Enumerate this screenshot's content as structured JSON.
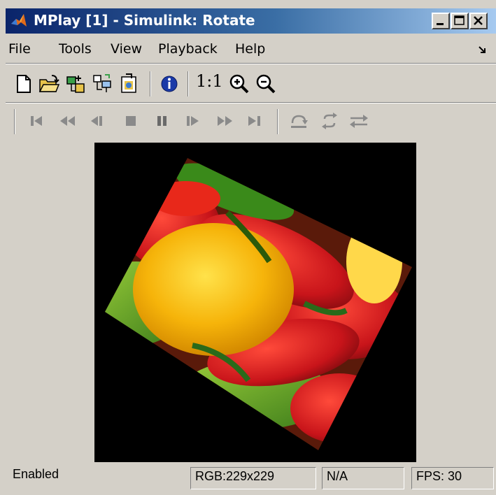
{
  "window": {
    "title": "MPlay [1] - Simulink: Rotate"
  },
  "menu": {
    "items": [
      "File",
      "Tools",
      "View",
      "Playback",
      "Help"
    ]
  },
  "toolbar": {
    "zoom_text": "1:1"
  },
  "video": {
    "content": "rotated image of colorful peppers (red, yellow, green)"
  },
  "status": {
    "state": "Enabled",
    "format": "RGB:229x229",
    "time": "N/A",
    "fps": "FPS: 30"
  },
  "colors": {
    "title_bar_start": "#0a246a",
    "title_bar_end": "#a6caf0",
    "chrome": "#d4d0c8",
    "video_background": "#000000"
  }
}
